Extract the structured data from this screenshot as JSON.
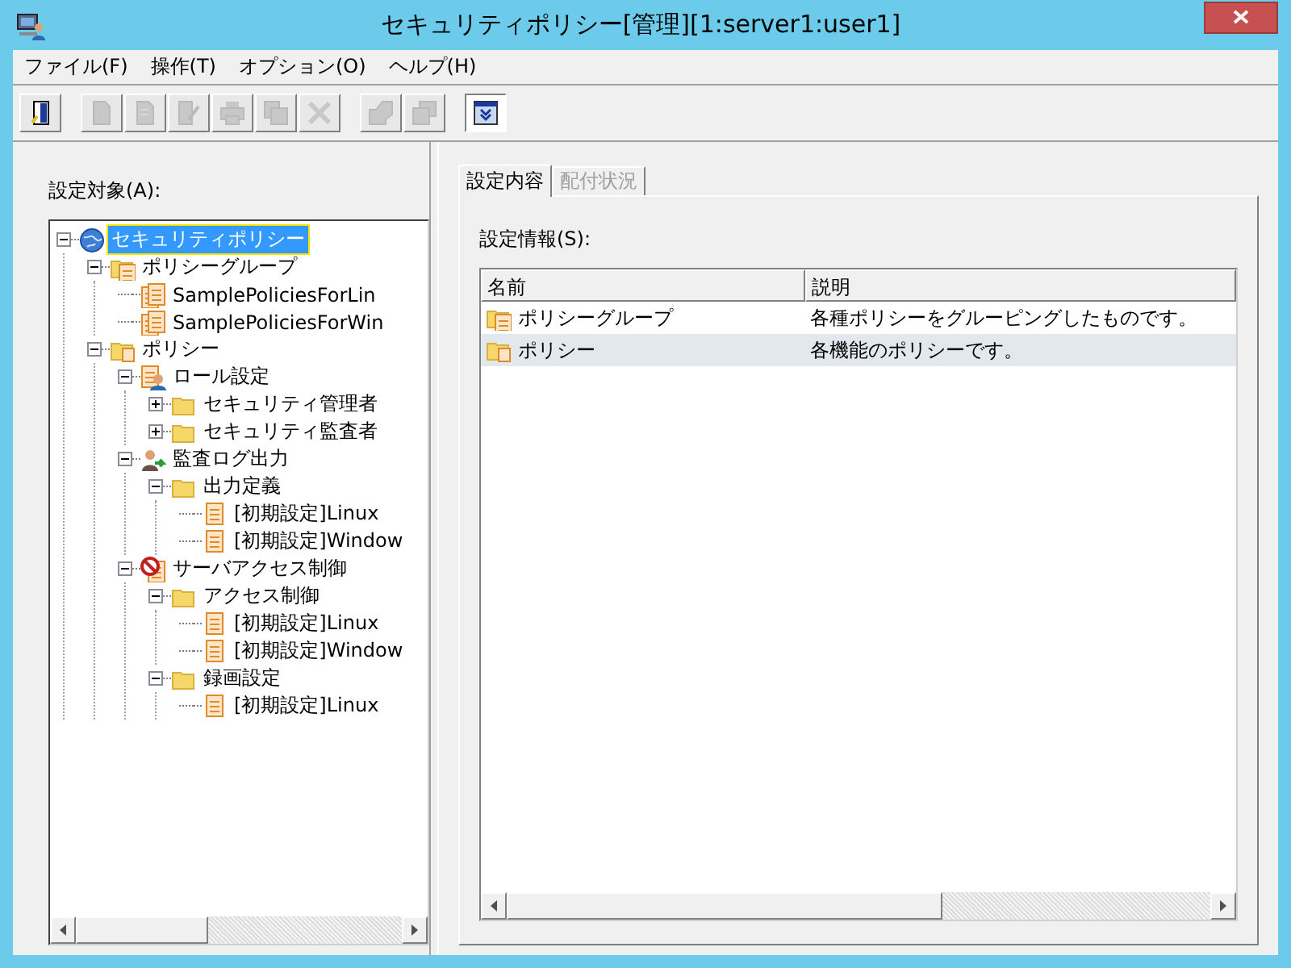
{
  "window": {
    "title": "セキュリティポリシー[管理][1:server1:user1]"
  },
  "menu": [
    "ファイル(F)",
    "操作(T)",
    "オプション(O)",
    "ヘルプ(H)"
  ],
  "toolbar": [
    [
      {
        "kind": "exit",
        "disabled": false
      }
    ],
    [
      {
        "kind": "new",
        "disabled": true
      },
      {
        "kind": "copy",
        "disabled": true
      },
      {
        "kind": "edit",
        "disabled": true
      },
      {
        "kind": "print",
        "disabled": true
      },
      {
        "kind": "duplicate",
        "disabled": true
      },
      {
        "kind": "delete",
        "disabled": true
      }
    ],
    [
      {
        "kind": "distribute",
        "disabled": true
      },
      {
        "kind": "stack",
        "disabled": true
      }
    ],
    [
      {
        "kind": "expand",
        "disabled": false
      }
    ]
  ],
  "tree_label": "設定対象(A):",
  "tree": [
    {
      "label": "セキュリティポリシー",
      "kind": "globe",
      "selected": true,
      "expanded": true,
      "children": [
        {
          "label": "ポリシーグループ",
          "kind": "group",
          "selected": false,
          "expanded": true,
          "children": [
            {
              "label": "SamplePoliciesForLin",
              "kind": "group-doc",
              "selected": false
            },
            {
              "label": "SamplePoliciesForWin",
              "kind": "group-doc",
              "selected": false
            }
          ]
        },
        {
          "label": "ポリシー",
          "kind": "policy",
          "selected": false,
          "expanded": true,
          "children": [
            {
              "label": "ロール設定",
              "kind": "role",
              "selected": false,
              "expanded": true,
              "children": [
                {
                  "label": "セキュリティ管理者",
                  "kind": "folder",
                  "selected": false,
                  "expanded": false
                },
                {
                  "label": "セキュリティ監査者",
                  "kind": "folder",
                  "selected": false,
                  "expanded": false
                }
              ]
            },
            {
              "label": "監査ログ出力",
              "kind": "audit",
              "selected": false,
              "expanded": true,
              "children": [
                {
                  "label": "出力定義",
                  "kind": "folder",
                  "selected": false,
                  "expanded": true,
                  "children": [
                    {
                      "label": "[初期設定]Linux",
                      "kind": "doc",
                      "selected": false
                    },
                    {
                      "label": "[初期設定]Window",
                      "kind": "doc",
                      "selected": false
                    }
                  ]
                }
              ]
            },
            {
              "label": "サーバアクセス制御",
              "kind": "access",
              "selected": false,
              "expanded": true,
              "children": [
                {
                  "label": "アクセス制御",
                  "kind": "folder",
                  "selected": false,
                  "expanded": true,
                  "children": [
                    {
                      "label": "[初期設定]Linux",
                      "kind": "doc",
                      "selected": false
                    },
                    {
                      "label": "[初期設定]Window",
                      "kind": "doc",
                      "selected": false
                    }
                  ]
                },
                {
                  "label": "録画設定",
                  "kind": "folder",
                  "selected": false,
                  "expanded": true,
                  "children": [
                    {
                      "label": "[初期設定]Linux",
                      "kind": "doc",
                      "selected": false
                    }
                  ]
                }
              ]
            }
          ]
        }
      ]
    }
  ],
  "tabs": [
    {
      "label": "設定内容",
      "selected": true,
      "disabled": false
    },
    {
      "label": "配付状況",
      "selected": false,
      "disabled": true
    }
  ],
  "list_label": "設定情報(S):",
  "table": {
    "columns": [
      "名前",
      "説明"
    ],
    "rows": [
      {
        "kind": "group",
        "name": "ポリシーグループ",
        "description": "各種ポリシーをグルーピングしたものです。",
        "selected": false
      },
      {
        "kind": "policy",
        "name": "ポリシー",
        "description": "各機能のポリシーです。",
        "selected": true
      }
    ]
  }
}
